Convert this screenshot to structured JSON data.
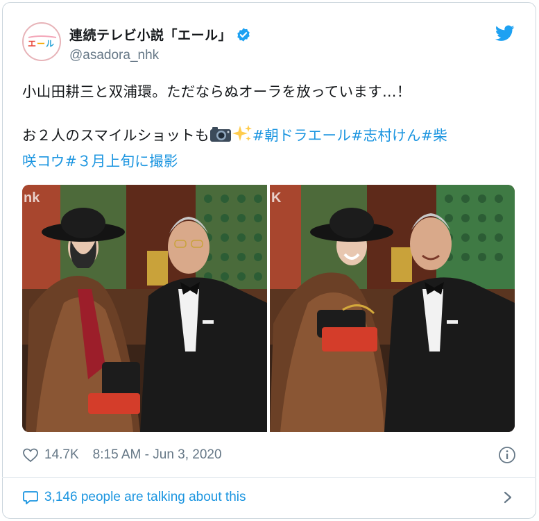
{
  "account": {
    "display_name": "連続テレビ小説「エール」",
    "handle": "@asadora_nhk",
    "avatar_text": "エール"
  },
  "tweet": {
    "line1": "小山田耕三と双浦環。ただならぬオーラを放っています…！",
    "line2_text": "お２人のスマイルショットも",
    "hashtag1": "#朝ドラエール",
    "hashtag2": "#志村けん",
    "hashtag3_part1": "#柴",
    "hashtag3_part2": "咲コウ",
    "hashtag4": "#３月上旬に撮影",
    "emojis": [
      "camera-emoji",
      "sparkles-emoji"
    ]
  },
  "media": {
    "watermark_left": "nk",
    "watermark_right": "K"
  },
  "meta": {
    "likes": "14.7K",
    "timestamp": "8:15 AM - Jun 3, 2020"
  },
  "footer": {
    "talking": "3,146 people are talking about this"
  },
  "colors": {
    "link": "#1b95e0",
    "secondary": "#657786",
    "verified": "#1da1f2",
    "border": "#ccd6dd"
  }
}
